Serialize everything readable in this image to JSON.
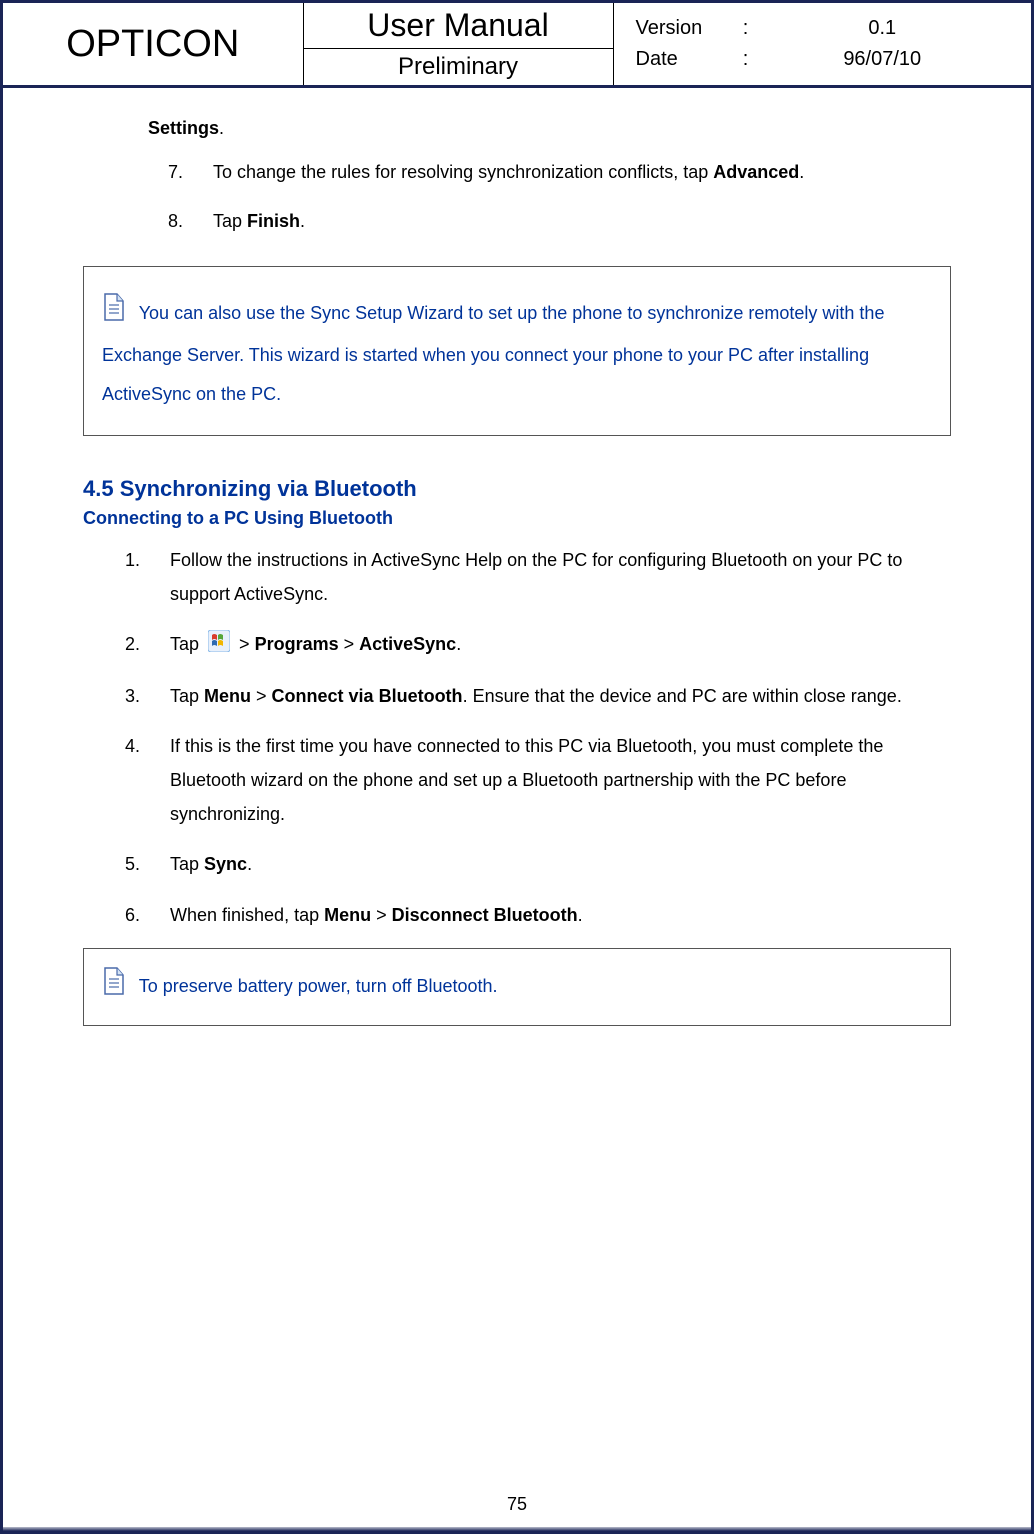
{
  "header": {
    "brand": "OPTICON",
    "title": "User Manual",
    "subtitle": "Preliminary",
    "version_label": "Version",
    "version_value": "0.1",
    "date_label": "Date",
    "date_value": "96/07/10",
    "colon": ":"
  },
  "intro": {
    "settings_line_bold": "Settings",
    "settings_line_period": ".",
    "list": [
      {
        "num": "7.",
        "pre": "To change the rules for resolving synchronization conflicts, tap ",
        "bold": "Advanced",
        "post": "."
      },
      {
        "num": "8.",
        "pre": "Tap ",
        "bold": "Finish",
        "post": "."
      }
    ]
  },
  "note1": "You can also use the Sync Setup Wizard to set up the phone to synchronize remotely with the Exchange Server. This wizard is started when you connect your phone to your PC after installing ActiveSync on the PC.",
  "section": {
    "heading": "4.5 Synchronizing via Bluetooth",
    "subheading": "Connecting to a PC Using Bluetooth",
    "items": {
      "i1": {
        "num": "1.",
        "text": "Follow the instructions in ActiveSync Help on the PC for configuring Bluetooth on your PC to support ActiveSync."
      },
      "i2": {
        "num": "2.",
        "pre": "Tap ",
        "gt1": " > ",
        "b1": "Programs",
        "gt2": " > ",
        "b2": "ActiveSync",
        "post": "."
      },
      "i3": {
        "num": "3.",
        "pre": "Tap ",
        "b1": "Menu",
        "gt1": " > ",
        "b2": "Connect via Bluetooth",
        "post": ". Ensure that the device and PC are within close range."
      },
      "i4": {
        "num": "4.",
        "text": "If this is the first time you have connected to this PC via Bluetooth, you must complete the Bluetooth wizard on the phone and set up a Bluetooth partnership with the PC before synchronizing."
      },
      "i5": {
        "num": "5.",
        "pre": "Tap ",
        "b1": "Sync",
        "post": "."
      },
      "i6": {
        "num": "6.",
        "pre": "When finished, tap ",
        "b1": "Menu",
        "gt1": " > ",
        "b2": "Disconnect Bluetooth",
        "post": "."
      }
    }
  },
  "note2": "To preserve battery power, turn off Bluetooth.",
  "page_number": "75"
}
